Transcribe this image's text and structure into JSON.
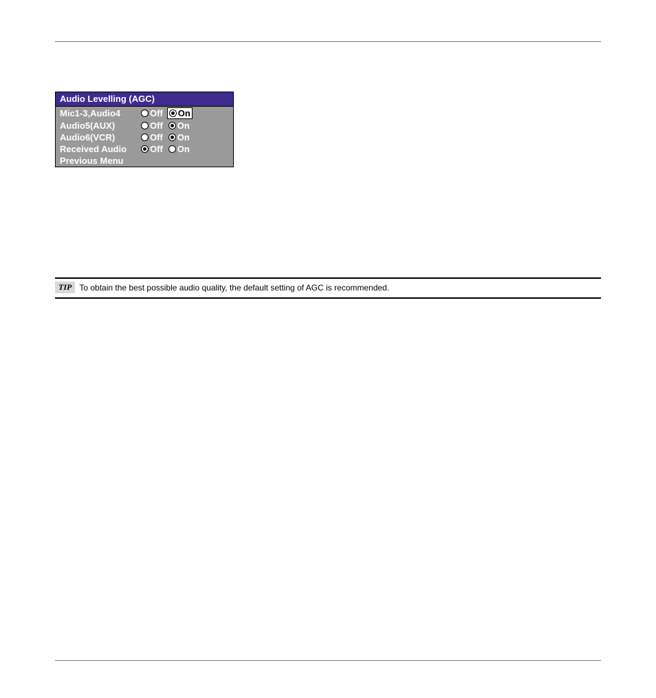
{
  "osd": {
    "title": "Audio Levelling (AGC)",
    "rows": [
      {
        "label": "Mic1-3,Audio4",
        "off": "Off",
        "on": "On",
        "offSelected": false,
        "onSelected": true,
        "highlight": "on"
      },
      {
        "label": "Audio5(AUX)",
        "off": "Off",
        "on": "On",
        "offSelected": false,
        "onSelected": true,
        "highlight": "none"
      },
      {
        "label": "Audio6(VCR)",
        "off": "Off",
        "on": "On",
        "offSelected": false,
        "onSelected": true,
        "highlight": "none"
      },
      {
        "label": "Received Audio",
        "off": "Off",
        "on": "On",
        "offSelected": true,
        "onSelected": false,
        "highlight": "none"
      }
    ],
    "footer": "Previous Menu"
  },
  "tip": {
    "badge": "TIP",
    "text": "To obtain the best possible audio quality, the default setting of AGC is recommended."
  }
}
